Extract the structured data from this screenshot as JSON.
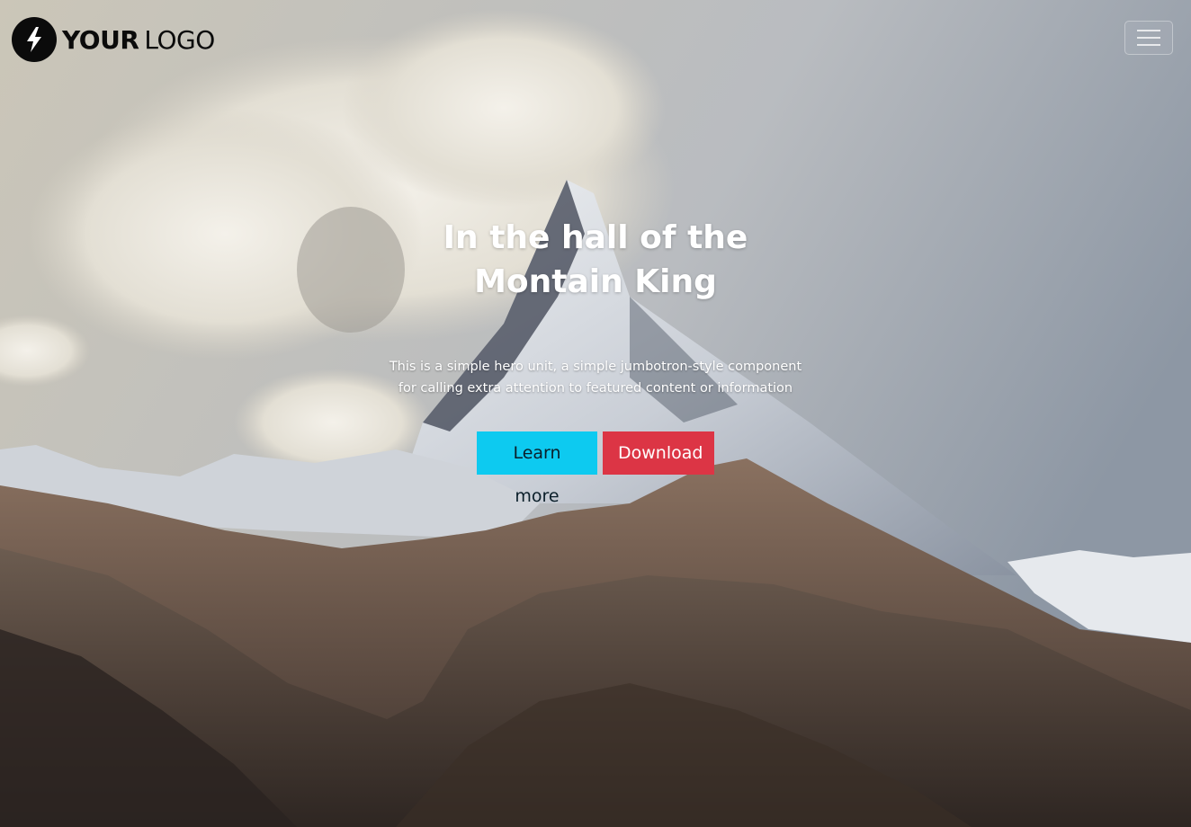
{
  "logo": {
    "bold_text": "YOUR",
    "light_text": "LOGO",
    "icon": "lightning-bolt-icon"
  },
  "navbar": {
    "toggler_icon": "hamburger-menu-icon"
  },
  "hero": {
    "title": "In the hall of the Montain King",
    "lead": "This is a simple hero unit, a simple jumbotron-style component for calling extra attention to featured content or information",
    "primary_button": "Learn more",
    "secondary_button": "Download"
  },
  "colors": {
    "info": "#0dcaf0",
    "danger": "#dc3545",
    "logo": "#0b0b0b"
  }
}
